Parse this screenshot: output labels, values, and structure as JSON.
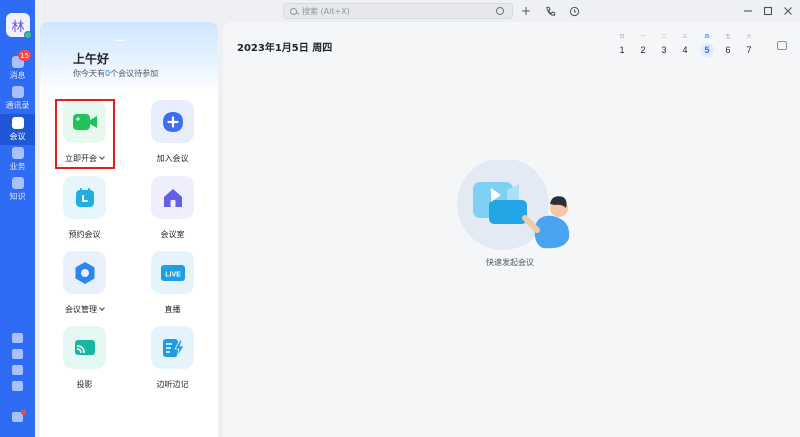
{
  "user": {
    "avatar_text": "林"
  },
  "rail": {
    "items": [
      {
        "label": "消息",
        "badge": "15"
      },
      {
        "label": "通讯录"
      },
      {
        "label": "会议"
      },
      {
        "label": "业务"
      },
      {
        "label": "知识"
      }
    ]
  },
  "topbar": {
    "search_placeholder": "搜索 (Alt+X)",
    "add_icon": "+"
  },
  "panel": {
    "greeting": "上午好",
    "subtitle_prefix": "你今天有",
    "subtitle_count": "0",
    "subtitle_suffix": "个会议待参加",
    "tiles": [
      {
        "label": "立即开会",
        "icon": "video-camera-icon"
      },
      {
        "label": "加入会议",
        "icon": "plus-icon"
      },
      {
        "label": "预约会议",
        "icon": "calendar-icon"
      },
      {
        "label": "会议室",
        "icon": "house-icon"
      },
      {
        "label": "会议管理",
        "icon": "gear-icon"
      },
      {
        "label": "直播",
        "icon": "live-icon"
      },
      {
        "label": "投影",
        "icon": "cast-icon"
      },
      {
        "label": "边听边记",
        "icon": "note-flash-icon"
      }
    ],
    "live_text": "LIVE"
  },
  "main": {
    "date_title": "2023年1月5日 周四",
    "week": [
      {
        "wd": "日",
        "day": "1"
      },
      {
        "wd": "一",
        "day": "2"
      },
      {
        "wd": "二",
        "day": "3"
      },
      {
        "wd": "三",
        "day": "4"
      },
      {
        "wd": "四",
        "day": "5"
      },
      {
        "wd": "五",
        "day": "6"
      },
      {
        "wd": "六",
        "day": "7"
      }
    ],
    "empty_caption": "快速发起会议"
  },
  "colors": {
    "brand": "#2f6cf5",
    "highlight_box": "#e02020"
  }
}
